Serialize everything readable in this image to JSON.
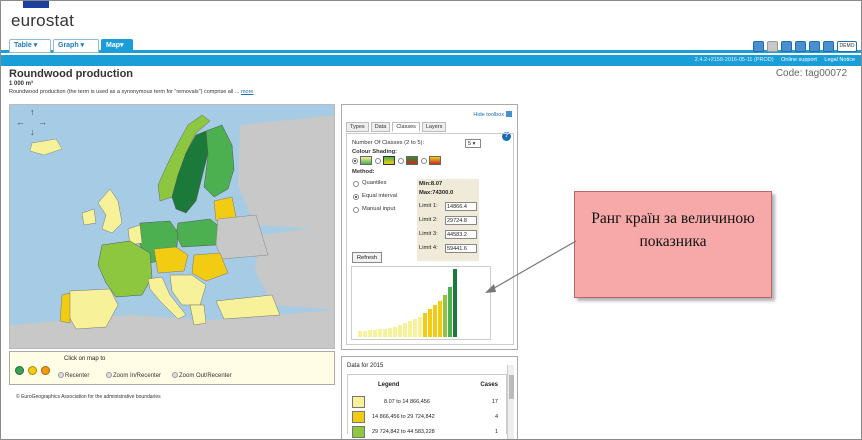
{
  "logo": "eurostat",
  "tabs": [
    {
      "label": "Table ▾",
      "active": false
    },
    {
      "label": "Graph ▾",
      "active": false
    },
    {
      "label": "Map▾",
      "active": true
    }
  ],
  "header": {
    "icons": [
      "print-icon",
      "page-icon",
      "info-icon",
      "save-icon",
      "export-icon",
      "window-icon",
      "demo-icon"
    ],
    "demo_label": "DEMO",
    "version": "2.4.2-r2159-2016-05-11 (PROD)",
    "support": "Online support",
    "legal": "Legal Notice"
  },
  "dataset": {
    "title": "Roundwood production",
    "code": "Code: tag00072",
    "unit": "1 000 m³",
    "description": "Roundwood production (the term is used as a synonymous term for \"removals\") comprise all ...",
    "more": "more"
  },
  "zoom_panel": {
    "label": "Click on map to",
    "options": [
      "Recenter",
      "Zoom In/Recenter",
      "Zoom Out/Recenter"
    ]
  },
  "copyright": "© EuroGeographics Association for the administrative boundaries",
  "toolbox": {
    "hide": "Hide toolbox",
    "tabs": [
      "Types",
      "Data",
      "Classes",
      "Layers"
    ],
    "active_tab": "Classes",
    "classes_label": "Number Of Classes (2 to 5):",
    "classes_value": "5 ▾",
    "colour_label": "Colour Shading:",
    "method_label": "Method:",
    "methods": [
      "Quantiles",
      "Equal interval",
      "Manual input"
    ],
    "selected_method": "Equal interval",
    "min_label": "Min:",
    "min_value": "8.07",
    "max_label": "Max:",
    "max_value": "74300.0",
    "limits": [
      {
        "label": "Limit 1:",
        "value": "14866.4"
      },
      {
        "label": "Limit 2:",
        "value": "29724.8"
      },
      {
        "label": "Limit 3:",
        "value": "44583.2"
      },
      {
        "label": "Limit 4:",
        "value": "59441.6"
      }
    ],
    "refresh": "Refresh"
  },
  "data_panel": {
    "title": "Data for 2015",
    "legend_header": "Legend",
    "cases_header": "Cases",
    "rows": [
      {
        "range": "8.07 to 14 866,456",
        "cases": "17",
        "color": "#f7f19a"
      },
      {
        "range": "14 866,456 to 29 724,842",
        "cases": "4",
        "color": "#f2cc12"
      },
      {
        "range": "29 724,842 to 44 583,228",
        "cases": "1",
        "color": "#8dc63f"
      }
    ]
  },
  "callout": {
    "text": "Ранг країн за величиною показника"
  },
  "colors": {
    "accent": "#1a9ed8",
    "class1": "#f7f19a",
    "class2": "#f2cc12",
    "class3": "#8dc63f",
    "class4": "#4caf50",
    "class5": "#1b7a3a",
    "nodata": "#c8c8c8",
    "sea": "#a6cbe4"
  }
}
